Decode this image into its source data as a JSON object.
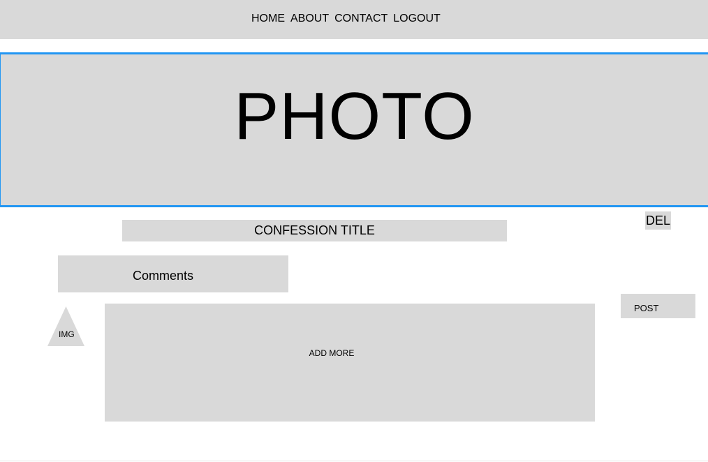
{
  "nav": {
    "links": [
      "HOME",
      "ABOUT",
      "CONTACT",
      "LOGOUT"
    ]
  },
  "banner": {
    "label": "PHOTO",
    "accent_color": "#2196f3",
    "fill_color": "#d9d9d9"
  },
  "post": {
    "delete_label": "DEL",
    "title": "CONFESSION TITLE"
  },
  "comments": {
    "heading": "Comments",
    "avatar_label": "IMG",
    "avatar_icon": "triangle-image-placeholder-icon",
    "input_placeholder": "ADD MORE",
    "submit_label": "POST"
  }
}
